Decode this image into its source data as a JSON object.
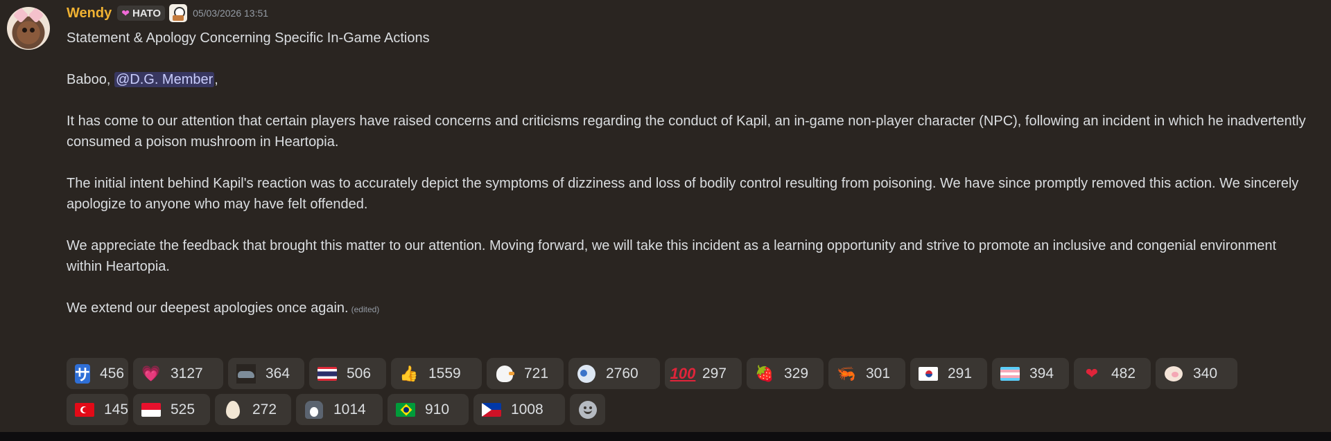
{
  "message": {
    "author": "Wendy",
    "role_tag": "HATO",
    "timestamp": "05/03/2026 13:51",
    "title": "Statement & Apology Concerning Specific In-Game Actions",
    "greeting": "Baboo,",
    "mention": "@D.G. Member",
    "greeting_suffix": ",",
    "paragraphs": [
      "It has come to our attention that certain players have raised concerns and criticisms regarding the conduct of Kapil, an in-game non-player character (NPC), following an incident in which he inadvertently consumed a poison mushroom in Heartopia.",
      "The initial intent behind Kapil's reaction was to accurately depict the symptoms of dizziness and loss of bodily control resulting from poisoning. We have since promptly removed this action. We sincerely apologize to anyone who may have felt offended.",
      "We appreciate the feedback that brought this matter to our attention. Moving forward, we will take this incident as a learning opportunity and strive to promote an inclusive and congenial environment within Heartopia."
    ],
    "closing": "We extend our deepest apologies once again.",
    "edited_label": "(edited)"
  },
  "colors": {
    "background": "#2a2521",
    "username": "#f0b232",
    "mention_bg": "#5865f24d",
    "reaction_bg": "#3a3632"
  },
  "reactions": [
    {
      "emoji": "katakana-sa",
      "glyph": "サ",
      "count": "456"
    },
    {
      "emoji": "pink-heart",
      "glyph": "💗",
      "count": "3127"
    },
    {
      "emoji": "seal",
      "glyph": "",
      "count": "364"
    },
    {
      "emoji": "flag-thailand",
      "glyph": "",
      "count": "506"
    },
    {
      "emoji": "thumbs-up",
      "glyph": "👍",
      "count": "1559"
    },
    {
      "emoji": "duck",
      "glyph": "",
      "count": "721"
    },
    {
      "emoji": "blue-bird",
      "glyph": "",
      "count": "2760"
    },
    {
      "emoji": "hundred",
      "glyph": "100",
      "count": "297"
    },
    {
      "emoji": "strawberry",
      "glyph": "🍓",
      "count": "329"
    },
    {
      "emoji": "shrimp",
      "glyph": "🦐",
      "count": "301"
    },
    {
      "emoji": "flag-south-korea",
      "glyph": "",
      "count": "291"
    },
    {
      "emoji": "flag-transgender",
      "glyph": "",
      "count": "394"
    },
    {
      "emoji": "red-heart",
      "glyph": "❤",
      "count": "482"
    },
    {
      "emoji": "pig",
      "glyph": "",
      "count": "340"
    },
    {
      "emoji": "flag-turkey",
      "glyph": "",
      "count": "145"
    },
    {
      "emoji": "flag-indonesia",
      "glyph": "",
      "count": "525"
    },
    {
      "emoji": "egg",
      "glyph": "",
      "count": "272"
    },
    {
      "emoji": "penguins",
      "glyph": "",
      "count": "1014"
    },
    {
      "emoji": "flag-brazil",
      "glyph": "",
      "count": "910"
    },
    {
      "emoji": "flag-philippines",
      "glyph": "",
      "count": "1008"
    }
  ]
}
